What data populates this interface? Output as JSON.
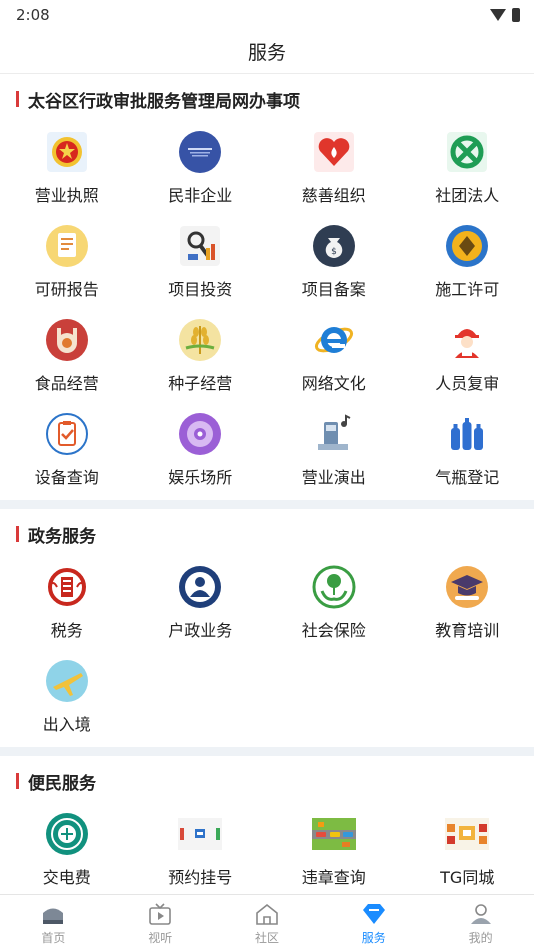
{
  "status_bar": {
    "time": "2:08"
  },
  "header": {
    "title": "服务"
  },
  "sections": [
    {
      "title": "太谷区行政审批服务管理局网办事项",
      "items": [
        {
          "label": "营业执照",
          "icon": "national-emblem-icon"
        },
        {
          "label": "民非企业",
          "icon": "civil-org-icon"
        },
        {
          "label": "慈善组织",
          "icon": "charity-heart-icon"
        },
        {
          "label": "社团法人",
          "icon": "association-knot-icon"
        },
        {
          "label": "可研报告",
          "icon": "report-document-icon"
        },
        {
          "label": "项目投资",
          "icon": "investment-magnifier-icon"
        },
        {
          "label": "项目备案",
          "icon": "money-bag-icon"
        },
        {
          "label": "施工许可",
          "icon": "construction-badge-icon"
        },
        {
          "label": "食品经营",
          "icon": "food-icon"
        },
        {
          "label": "种子经营",
          "icon": "seed-wheat-icon"
        },
        {
          "label": "网络文化",
          "icon": "internet-explorer-icon"
        },
        {
          "label": "人员复审",
          "icon": "worker-icon"
        },
        {
          "label": "设备查询",
          "icon": "clipboard-check-icon"
        },
        {
          "label": "娱乐场所",
          "icon": "disc-icon"
        },
        {
          "label": "营业演出",
          "icon": "performance-stage-icon"
        },
        {
          "label": "气瓶登记",
          "icon": "gas-cylinder-icon"
        }
      ]
    },
    {
      "title": "政务服务",
      "items": [
        {
          "label": "税务",
          "icon": "tax-emblem-icon"
        },
        {
          "label": "户政业务",
          "icon": "person-icon"
        },
        {
          "label": "社会保险",
          "icon": "tree-hands-icon"
        },
        {
          "label": "教育培训",
          "icon": "graduation-cap-icon"
        },
        {
          "label": "出入境",
          "icon": "airplane-icon"
        }
      ]
    },
    {
      "title": "便民服务",
      "items": [
        {
          "label": "交电费",
          "icon": "grid-power-icon"
        },
        {
          "label": "预约挂号",
          "icon": "appointment-icon"
        },
        {
          "label": "违章查询",
          "icon": "traffic-icon"
        },
        {
          "label": "TG同城",
          "icon": "market-icon"
        }
      ]
    }
  ],
  "tab_bar": [
    {
      "label": "首页",
      "icon": "home-icon"
    },
    {
      "label": "视听",
      "icon": "tv-icon"
    },
    {
      "label": "社区",
      "icon": "community-house-icon"
    },
    {
      "label": "服务",
      "icon": "diamond-icon",
      "active": true
    },
    {
      "label": "我的",
      "icon": "profile-icon"
    }
  ],
  "colors": {
    "accent": "#1a8cff",
    "section_bar": "#d93a3a",
    "divider": "#eef2f6"
  }
}
